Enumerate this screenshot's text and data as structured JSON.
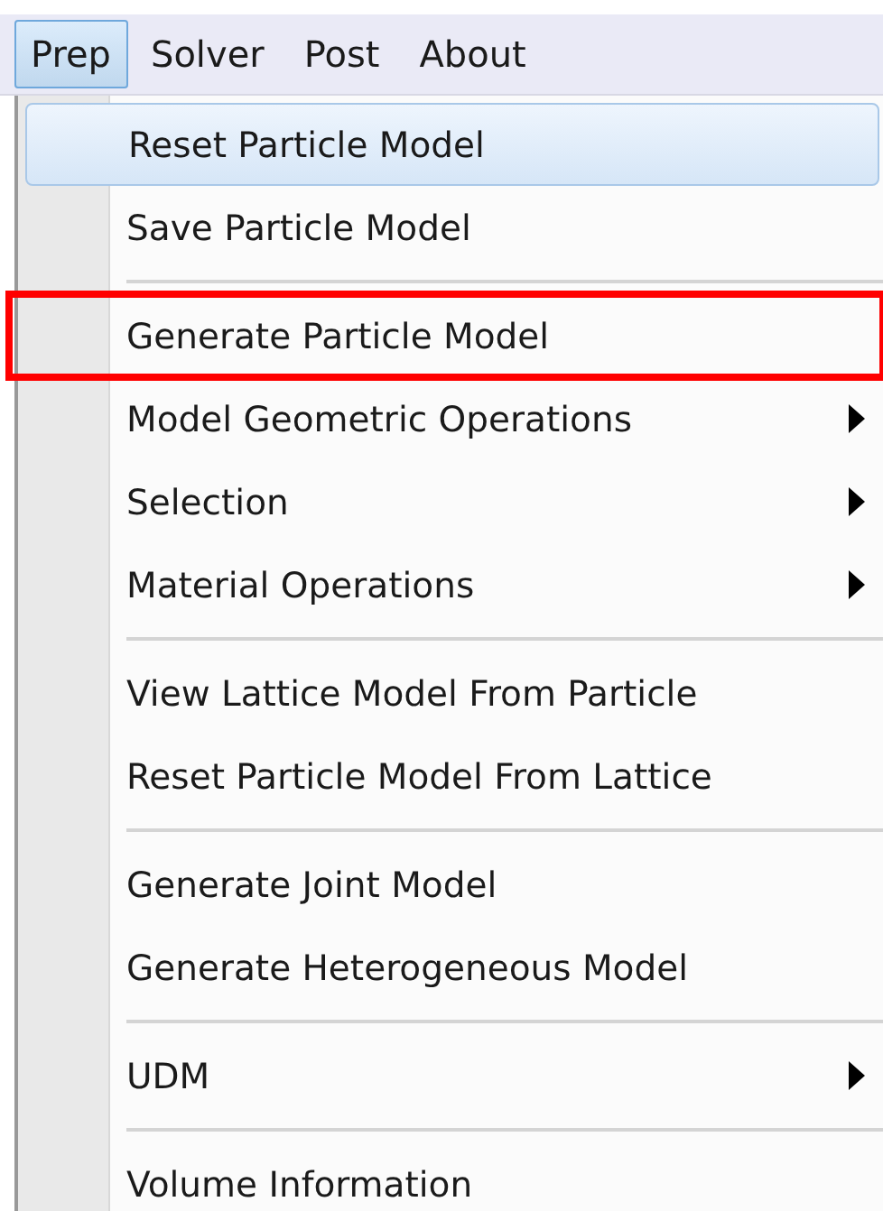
{
  "menu_bar": [
    {
      "label": "Prep",
      "selected": true
    },
    {
      "label": "Solver",
      "selected": false
    },
    {
      "label": "Post",
      "selected": false
    },
    {
      "label": "About",
      "selected": false
    }
  ],
  "menu": [
    {
      "kind": "item",
      "label": "Reset Particle Model",
      "hovered": true,
      "submenu": false,
      "annotated": false
    },
    {
      "kind": "item",
      "label": "Save Particle Model",
      "hovered": false,
      "submenu": false,
      "annotated": false
    },
    {
      "kind": "separator"
    },
    {
      "kind": "item",
      "label": "Generate Particle Model",
      "hovered": false,
      "submenu": false,
      "annotated": true
    },
    {
      "kind": "item",
      "label": "Model Geometric Operations",
      "hovered": false,
      "submenu": true,
      "annotated": false
    },
    {
      "kind": "item",
      "label": "Selection",
      "hovered": false,
      "submenu": true,
      "annotated": false
    },
    {
      "kind": "item",
      "label": "Material Operations",
      "hovered": false,
      "submenu": true,
      "annotated": false
    },
    {
      "kind": "separator"
    },
    {
      "kind": "item",
      "label": "View Lattice Model From Particle",
      "hovered": false,
      "submenu": false,
      "annotated": false
    },
    {
      "kind": "item",
      "label": "Reset Particle Model From Lattice",
      "hovered": false,
      "submenu": false,
      "annotated": false
    },
    {
      "kind": "separator"
    },
    {
      "kind": "item",
      "label": "Generate Joint Model",
      "hovered": false,
      "submenu": false,
      "annotated": false
    },
    {
      "kind": "item",
      "label": "Generate Heterogeneous Model",
      "hovered": false,
      "submenu": false,
      "annotated": false
    },
    {
      "kind": "separator"
    },
    {
      "kind": "item",
      "label": "UDM",
      "hovered": false,
      "submenu": true,
      "annotated": false
    },
    {
      "kind": "separator"
    },
    {
      "kind": "item",
      "label": "Volume Information",
      "hovered": false,
      "submenu": false,
      "annotated": false
    }
  ]
}
